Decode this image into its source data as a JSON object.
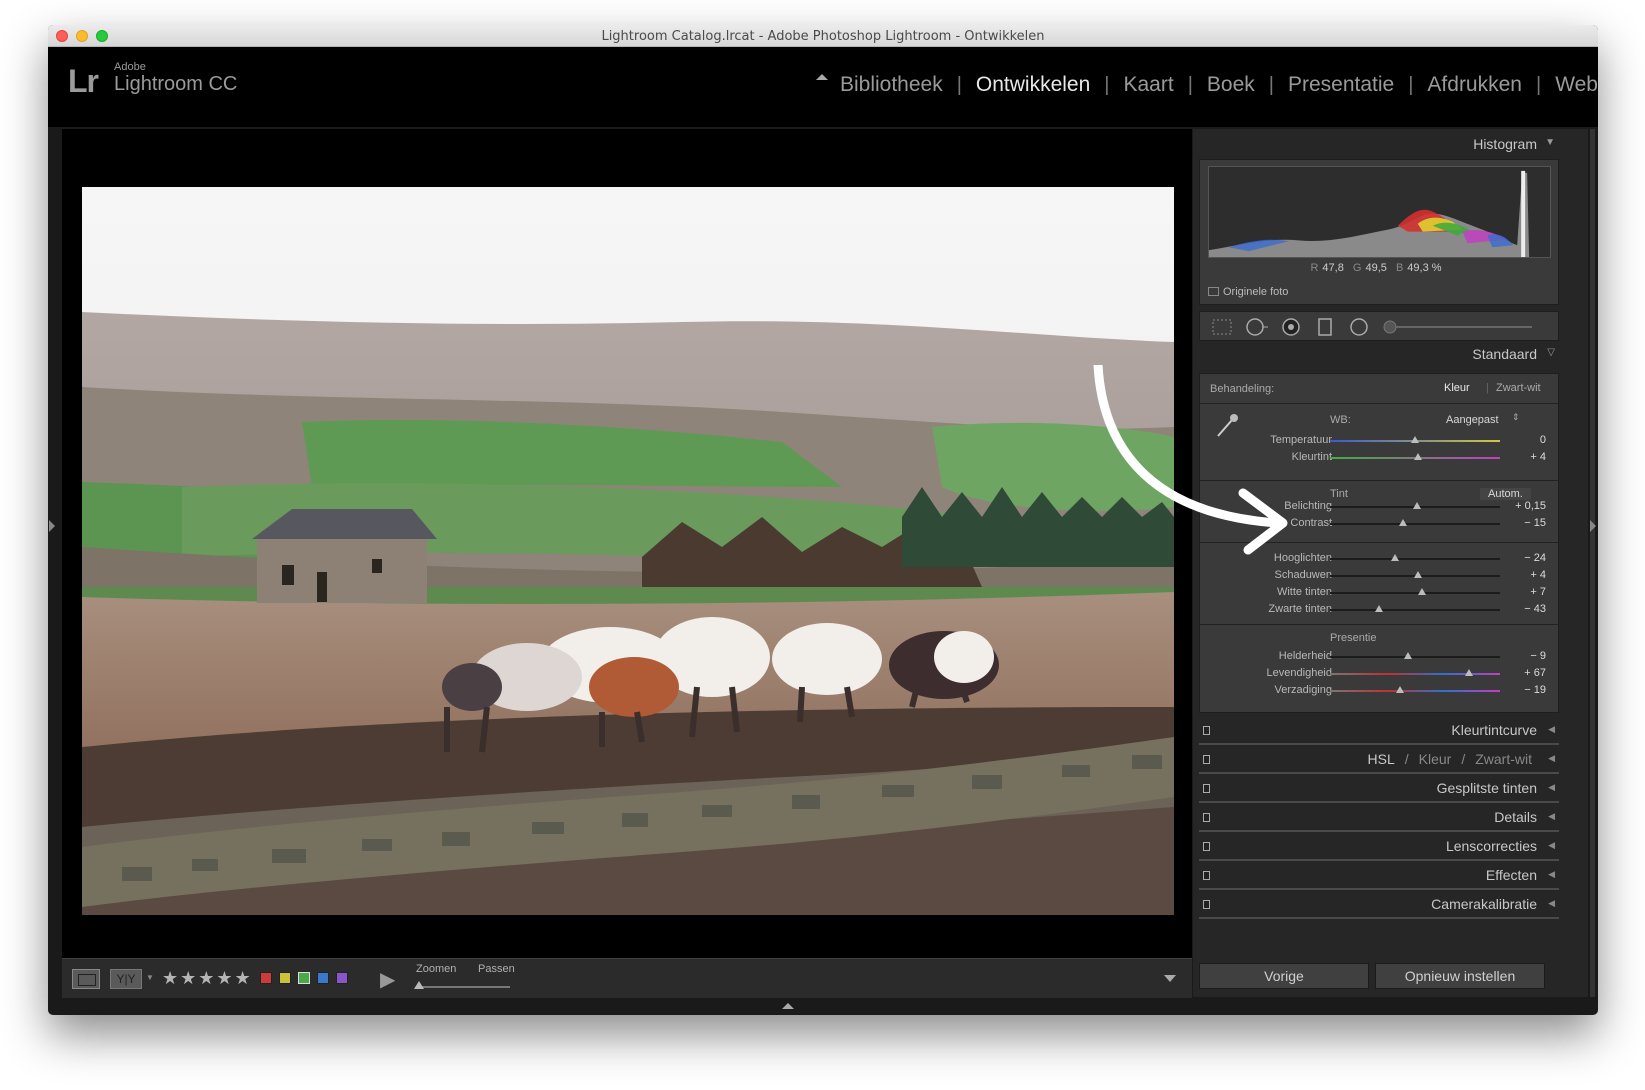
{
  "window": {
    "title": "Lightroom Catalog.lrcat - Adobe Photoshop Lightroom - Ontwikkelen"
  },
  "brand": {
    "logo": "Lr",
    "adobe": "Adobe",
    "product": "Lightroom CC"
  },
  "modules": [
    {
      "label": "Bibliotheek",
      "active": false
    },
    {
      "label": "Ontwikkelen",
      "active": true
    },
    {
      "label": "Kaart",
      "active": false
    },
    {
      "label": "Boek",
      "active": false
    },
    {
      "label": "Presentatie",
      "active": false
    },
    {
      "label": "Afdrukken",
      "active": false
    },
    {
      "label": "Web",
      "active": false
    }
  ],
  "histogram": {
    "title": "Histogram",
    "r_label": "R",
    "r_value": "47,8",
    "g_label": "G",
    "g_value": "49,5",
    "b_label": "B",
    "b_value": "49,3 %",
    "original_photo_label": "Originele foto"
  },
  "basic": {
    "preset_title": "Standaard",
    "treatment_label": "Behandeling:",
    "treatment_color": "Kleur",
    "treatment_bw": "Zwart-wit",
    "wb_label": "WB:",
    "wb_value": "Aangepast",
    "tone_label": "Tint",
    "auto_label": "Autom.",
    "presence_label": "Presentie",
    "wb_sliders": [
      {
        "label": "Temperatuur",
        "value": "0",
        "level": 0.5
      },
      {
        "label": "Kleurtint",
        "value": "+ 4",
        "level": 0.52
      }
    ],
    "tone_sliders": [
      {
        "label": "Belichting",
        "value": "+ 0,15",
        "level": 0.51
      },
      {
        "label": "Contrast",
        "value": "− 15",
        "level": 0.43
      }
    ],
    "tone_sliders_2": [
      {
        "label": "Hooglichten",
        "value": "− 24",
        "level": 0.38
      },
      {
        "label": "Schaduwen",
        "value": "+ 4",
        "level": 0.52
      },
      {
        "label": "Witte tinten",
        "value": "+ 7",
        "level": 0.54
      },
      {
        "label": "Zwarte tinten",
        "value": "− 43",
        "level": 0.29
      }
    ],
    "presence_sliders": [
      {
        "label": "Helderheid",
        "value": "− 9",
        "level": 0.46
      },
      {
        "label": "Levendigheid",
        "value": "+ 67",
        "level": 0.82
      },
      {
        "label": "Verzadiging",
        "value": "− 19",
        "level": 0.41
      }
    ]
  },
  "collapsed_panels": [
    {
      "label": "Kleurtintcurve"
    },
    {
      "label": "Gesplitste tinten"
    },
    {
      "label": "Details"
    },
    {
      "label": "Lenscorrecties"
    },
    {
      "label": "Effecten"
    },
    {
      "label": "Camerakalibratie"
    }
  ],
  "hsl_panel": {
    "hsl": "HSL",
    "slash": "/",
    "color": "Kleur",
    "bw": "Zwart-wit"
  },
  "buttons": {
    "previous": "Vorige",
    "reset": "Opnieuw instellen"
  },
  "toolbar": {
    "yy": "Y|Y",
    "stars": "★★★★★",
    "zoom_label": "Zoomen",
    "fit_label": "Passen",
    "zoom_level": 0,
    "flags": [
      "#cc3b3b",
      "#c9c23a",
      "#4aaa46",
      "#3a78cc",
      "#8a55c8"
    ]
  },
  "colors": {
    "accent_active": "#e8e8e8",
    "panel_bg": "#3a3a3a"
  }
}
